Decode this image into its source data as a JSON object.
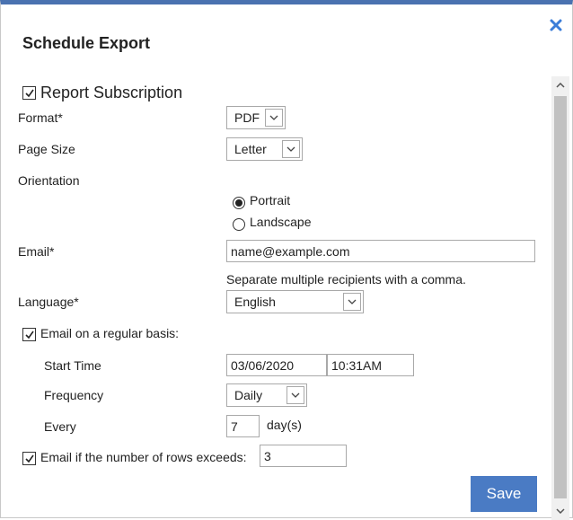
{
  "dialog": {
    "title": "Schedule Export",
    "close_icon": "close-x-icon"
  },
  "report_subscription": {
    "label": "Report Subscription",
    "checked": true
  },
  "format": {
    "label": "Format*",
    "value": "PDF"
  },
  "page_size": {
    "label": "Page Size",
    "value": "Letter"
  },
  "orientation": {
    "label": "Orientation",
    "options": [
      {
        "label": "Portrait",
        "selected": true
      },
      {
        "label": "Landscape",
        "selected": false
      }
    ]
  },
  "email": {
    "label": "Email*",
    "value": "name@example.com",
    "hint": "Separate multiple recipients with a comma."
  },
  "language": {
    "label": "Language*",
    "value": "English"
  },
  "regular_basis": {
    "label": "Email on a regular basis:",
    "checked": true,
    "start_time": {
      "label": "Start Time",
      "date": "03/06/2020",
      "time": "10:31AM"
    },
    "frequency": {
      "label": "Frequency",
      "value": "Daily"
    },
    "every": {
      "label": "Every",
      "value": "7",
      "unit": "day(s)"
    }
  },
  "rows_exceed": {
    "label": "Email if the number of rows exceeds:",
    "checked": true,
    "value": "3"
  },
  "actions": {
    "save_label": "Save"
  },
  "colors": {
    "accent": "#4a72b0",
    "button": "#4a7bc4",
    "close_icon": "#3b7dd8"
  }
}
